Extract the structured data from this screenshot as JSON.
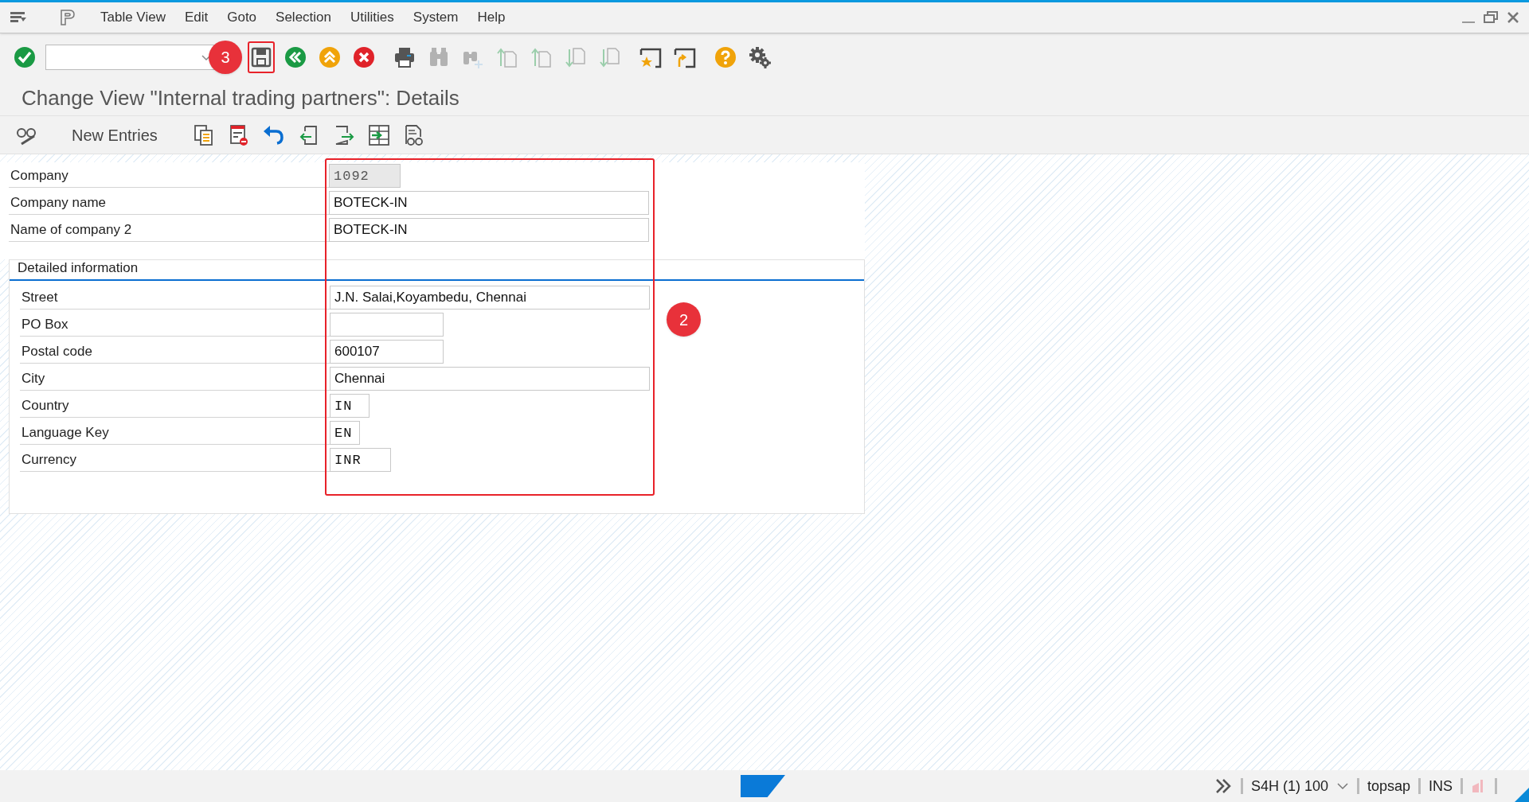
{
  "menu_bar": {
    "items": [
      {
        "label": "Table View"
      },
      {
        "label": "Edit"
      },
      {
        "label": "Goto"
      },
      {
        "label": "Selection"
      },
      {
        "label": "Utilities"
      },
      {
        "label": "System"
      },
      {
        "label": "Help"
      }
    ]
  },
  "toolbar": {
    "items": [
      {
        "kind": "enter",
        "disabled": false
      },
      {
        "kind": "command-field"
      },
      {
        "kind": "save",
        "disabled": false,
        "highlighted": true
      },
      {
        "kind": "back",
        "disabled": false
      },
      {
        "kind": "exit",
        "disabled": false
      },
      {
        "kind": "cancel",
        "disabled": false
      },
      {
        "kind": "print",
        "disabled": false
      },
      {
        "kind": "find",
        "disabled": true
      },
      {
        "kind": "find-next",
        "disabled": true
      },
      {
        "kind": "first-page",
        "disabled": true
      },
      {
        "kind": "prev-page",
        "disabled": true
      },
      {
        "kind": "next-page",
        "disabled": true
      },
      {
        "kind": "last-page",
        "disabled": true
      },
      {
        "kind": "new-session",
        "disabled": false
      },
      {
        "kind": "shortcut",
        "disabled": false
      },
      {
        "kind": "help",
        "disabled": false
      },
      {
        "kind": "settings",
        "disabled": false
      }
    ]
  },
  "title": "Change View \"Internal trading partners\": Details",
  "app_toolbar": {
    "items": [
      {
        "kind": "display-change"
      },
      {
        "kind": "text",
        "label": "New Entries"
      },
      {
        "kind": "copy"
      },
      {
        "kind": "delete"
      },
      {
        "kind": "undo"
      },
      {
        "kind": "previous"
      },
      {
        "kind": "next"
      },
      {
        "kind": "variable-list"
      },
      {
        "kind": "where-used"
      }
    ]
  },
  "fields": [
    {
      "label": "Company",
      "value": "1092",
      "kind": "code",
      "editable": false
    },
    {
      "label": "Company name",
      "value": "BOTECK-IN",
      "kind": "text",
      "editable": true
    },
    {
      "label": "Name of company 2",
      "value": "BOTECK-IN",
      "kind": "text",
      "editable": true
    }
  ],
  "detailed_information": {
    "title": "Detailed information",
    "fields": [
      {
        "label": "Street",
        "value": "J.N. Salai,Koyambedu, Chennai",
        "kind": "text",
        "editable": true
      },
      {
        "label": "PO Box",
        "kind": "text",
        "editable": true
      },
      {
        "label": "Postal code",
        "value": "600107",
        "kind": "text",
        "editable": true
      },
      {
        "label": "City",
        "value": "Chennai",
        "kind": "text",
        "editable": true
      },
      {
        "label": "Country",
        "value": "IN",
        "kind": "code",
        "editable": true
      },
      {
        "label": "Language Key",
        "value": "EN",
        "kind": "code",
        "editable": true
      },
      {
        "label": "Currency",
        "value": "INR",
        "kind": "code",
        "editable": true
      }
    ]
  },
  "annotations": [
    {
      "label": "3"
    },
    {
      "label": "2"
    }
  ],
  "status_bar": {
    "system": "S4H (1) 100",
    "user": "topsap",
    "mode": "INS"
  }
}
